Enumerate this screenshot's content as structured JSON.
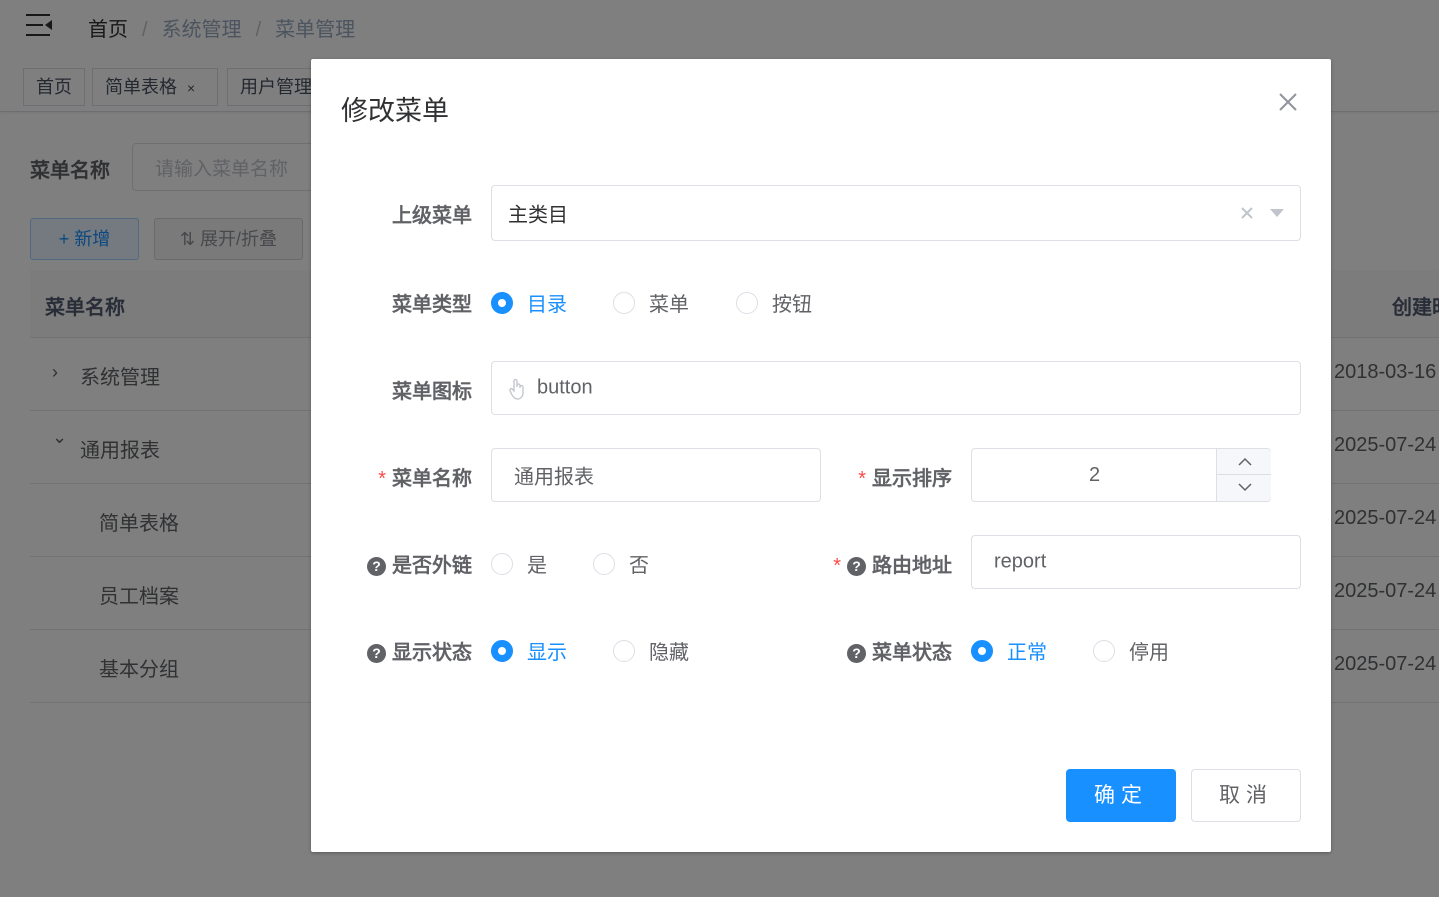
{
  "breadcrumb": [
    "首页",
    "系统管理",
    "菜单管理"
  ],
  "tags": [
    {
      "label": "首页"
    },
    {
      "label": "简单表格",
      "close": "×"
    },
    {
      "label": "用户管理"
    }
  ],
  "search": {
    "label": "菜单名称",
    "placeholder": "请输入菜单名称"
  },
  "toolbar": {
    "add_icon": "+",
    "add_label": "新增",
    "expand_icon": "⇅",
    "expand_label": "展开/折叠"
  },
  "table": {
    "headers": [
      "菜单名称",
      "创建时"
    ],
    "rows": [
      {
        "name": "系统管理",
        "arrow": "›",
        "date": "2018-03-16"
      },
      {
        "name": "通用报表",
        "arrow": "⌄",
        "date": "2025-07-24"
      },
      {
        "name": "简单表格",
        "date": "2025-07-24"
      },
      {
        "name": "员工档案",
        "date": "2025-07-24"
      },
      {
        "name": "基本分组",
        "date": "2025-07-24"
      }
    ]
  },
  "dialog": {
    "title": "修改菜单",
    "parent": {
      "label": "上级菜单",
      "value": "主类目"
    },
    "menu_type": {
      "label": "菜单类型",
      "options": [
        "目录",
        "菜单",
        "按钮"
      ],
      "selected": "目录"
    },
    "icon": {
      "label": "菜单图标",
      "value": "button",
      "icon_name": "hand-pointer-icon"
    },
    "name": {
      "required": "*",
      "label": "菜单名称",
      "value": "通用报表"
    },
    "sort": {
      "required": "*",
      "label": "显示排序",
      "value": "2"
    },
    "external": {
      "help": "?",
      "label": "是否外链",
      "options": [
        "是",
        "否"
      ],
      "selected": ""
    },
    "route": {
      "required": "*",
      "help": "?",
      "label": "路由地址",
      "value": "report"
    },
    "visible": {
      "help": "?",
      "label": "显示状态",
      "options": [
        "显示",
        "隐藏"
      ],
      "selected": "显示"
    },
    "status": {
      "help": "?",
      "label": "菜单状态",
      "options": [
        "正常",
        "停用"
      ],
      "selected": "正常"
    },
    "confirm": "确定",
    "cancel": "取消"
  },
  "colors": {
    "primary": "#1890ff",
    "danger": "#ff4949",
    "mask": "rgba(0,0,0,0.5)"
  }
}
